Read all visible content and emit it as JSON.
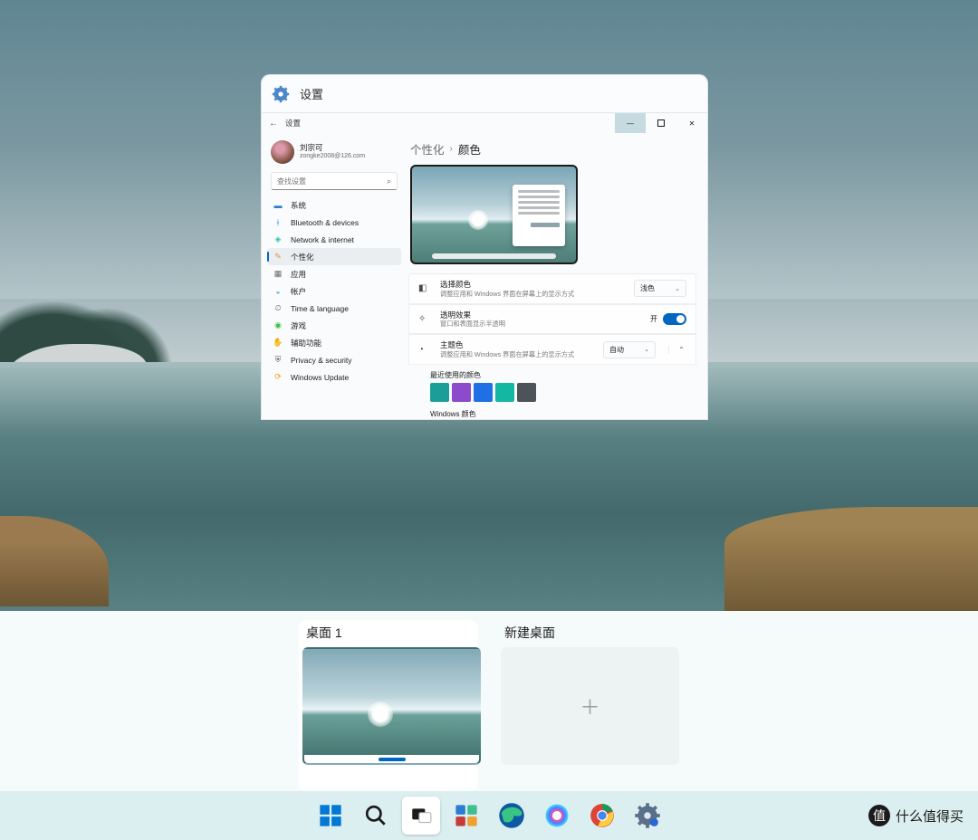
{
  "header": {
    "title": "设置"
  },
  "window_controls": {
    "minimize": "—",
    "maximize": "▢",
    "close": "✕"
  },
  "topbar": {
    "back": "←",
    "title": "设置"
  },
  "user": {
    "name": "刘宗可",
    "email": "zongke2008@126.com"
  },
  "search": {
    "placeholder": "查找设置"
  },
  "sidebar": {
    "items": [
      {
        "label": "系统",
        "icon": "system-icon",
        "color": "#2b7cd3"
      },
      {
        "label": "Bluetooth & devices",
        "icon": "bluetooth-icon",
        "color": "#1f8ef1"
      },
      {
        "label": "Network & internet",
        "icon": "wifi-icon",
        "color": "#2fc4b2"
      },
      {
        "label": "个性化",
        "icon": "brush-icon",
        "color": "#d09844",
        "active": true
      },
      {
        "label": "应用",
        "icon": "apps-icon",
        "color": "#6a6a6a"
      },
      {
        "label": "帐户",
        "icon": "accounts-icon",
        "color": "#5aa9e6"
      },
      {
        "label": "Time & language",
        "icon": "time-icon",
        "color": "#6a6a6a"
      },
      {
        "label": "游戏",
        "icon": "gaming-icon",
        "color": "#3fbf3f"
      },
      {
        "label": "辅助功能",
        "icon": "accessibility-icon",
        "color": "#3a79d6"
      },
      {
        "label": "Privacy & security",
        "icon": "privacy-icon",
        "color": "#5a5a5a"
      },
      {
        "label": "Windows Update",
        "icon": "update-icon",
        "color": "#f39c12"
      }
    ]
  },
  "breadcrumb": {
    "parent": "个性化",
    "current": "颜色"
  },
  "cards": {
    "mode": {
      "title": "选择颜色",
      "desc": "调整应用和 Windows 界面在屏幕上的显示方式",
      "value": "浅色"
    },
    "transparency": {
      "title": "透明效果",
      "desc": "窗口和表面显示半透明",
      "state_label": "开"
    },
    "accent": {
      "title": "主题色",
      "desc": "调整应用和 Windows 界面在屏幕上的显示方式",
      "value": "自动"
    }
  },
  "recent_colors": {
    "title": "最近使用的颜色",
    "swatches": [
      "#1b9e97",
      "#8b4bca",
      "#1f6fe5",
      "#14b8a2",
      "#4c545a"
    ]
  },
  "windows_colors": {
    "title": "Windows 颜色",
    "swatches": [
      "#ffb900",
      "#ff8c00",
      "#f7630c",
      "#ca5010",
      "#da3b01",
      "#ef6950",
      "#d13438",
      "#ff4343",
      "#e74856"
    ]
  },
  "taskview": {
    "desktop_label": "桌面 1",
    "new_label": "新建桌面"
  },
  "watermark": {
    "text": "什么值得买"
  }
}
